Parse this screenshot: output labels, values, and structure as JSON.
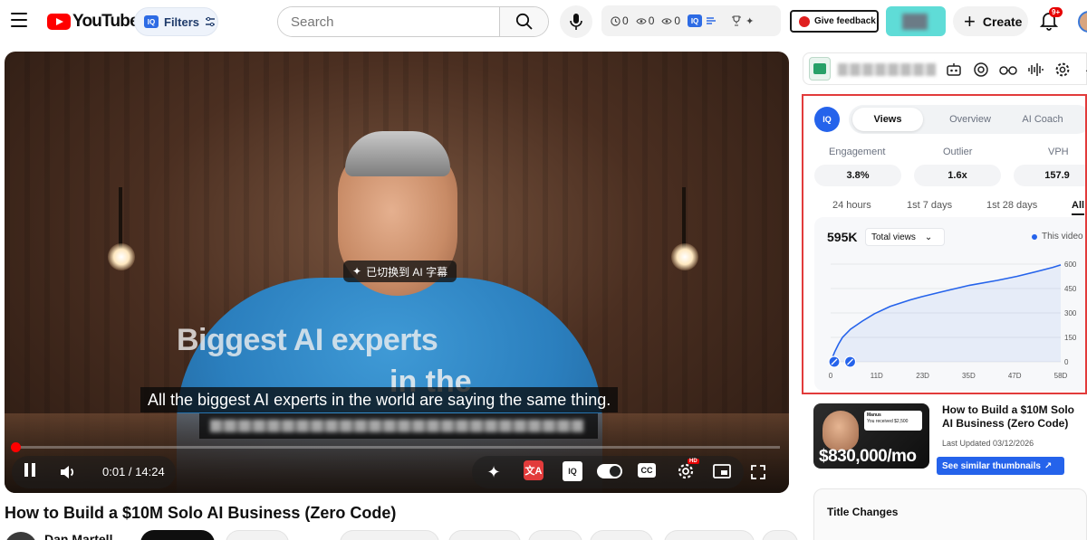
{
  "header": {
    "logo_text": "YouTube",
    "filters_label": "Filters",
    "iq_badge": "IQ",
    "search_placeholder": "Search",
    "stats": [
      {
        "icon": "clock-icon",
        "value": "0"
      },
      {
        "icon": "eye-icon",
        "value": "0"
      },
      {
        "icon": "eye-icon",
        "value": "0"
      }
    ],
    "feedback_label": "Give feedback",
    "create_label": "Create",
    "notification_badge": "9+"
  },
  "player": {
    "ai_toast": "已切换到 AI 字幕",
    "overlay_line1": "Biggest AI experts",
    "overlay_line2": "in the",
    "caption": "All the biggest AI experts in the world are saying the same thing.",
    "time_current": "0:01",
    "time_separator": " / ",
    "time_total": "14:24",
    "progress_fraction": 0.0012,
    "hd_badge": "HD",
    "cc_label": "CC"
  },
  "video": {
    "title": "How to Build a $10M Solo AI Business (Zero Code)",
    "channel": "Dan Martell"
  },
  "panel": {
    "logo": "IQ",
    "tabs": [
      {
        "label": "Views",
        "active": true
      },
      {
        "label": "Overview",
        "active": false
      },
      {
        "label": "AI Coach",
        "active": false
      }
    ],
    "metrics": [
      {
        "label": "Engagement",
        "value": "3.8%"
      },
      {
        "label": "Outlier",
        "value": "1.6x"
      },
      {
        "label": "VPH",
        "value": "157.9"
      }
    ],
    "ranges": [
      {
        "label": "24 hours",
        "active": false
      },
      {
        "label": "1st 7 days",
        "active": false
      },
      {
        "label": "1st 28 days",
        "active": false
      },
      {
        "label": "All",
        "active": true
      }
    ],
    "total": "595K",
    "dropdown": "Total views",
    "legend": "This video",
    "accent": "#2563eb"
  },
  "chart_data": {
    "type": "area",
    "x": [
      0,
      1,
      2,
      3,
      5,
      8,
      11,
      15,
      20,
      23,
      28,
      35,
      42,
      47,
      52,
      56,
      58
    ],
    "values": [
      0,
      60,
      110,
      150,
      200,
      250,
      295,
      340,
      380,
      400,
      430,
      470,
      500,
      525,
      555,
      580,
      595
    ],
    "x_ticks": [
      "0",
      "11D",
      "23D",
      "35D",
      "47D",
      "58D"
    ],
    "y_ticks": [
      "0",
      "150",
      "300",
      "450",
      "600"
    ],
    "ylim": [
      0,
      600
    ],
    "xlim": [
      0,
      58
    ],
    "series": [
      {
        "name": "This video",
        "color": "#2563eb"
      }
    ]
  },
  "sidebar_video": {
    "title": "How to Build a $10M Solo AI Business (Zero Code)",
    "updated": "Last Updated 03/12/2026",
    "similar_label": "See similar thumbnails",
    "thumb_price": "$830,000/mo",
    "thumb_notif_app": "Manus",
    "thumb_notif_text": "You received $2,500"
  },
  "title_changes": {
    "label": "Title Changes"
  }
}
